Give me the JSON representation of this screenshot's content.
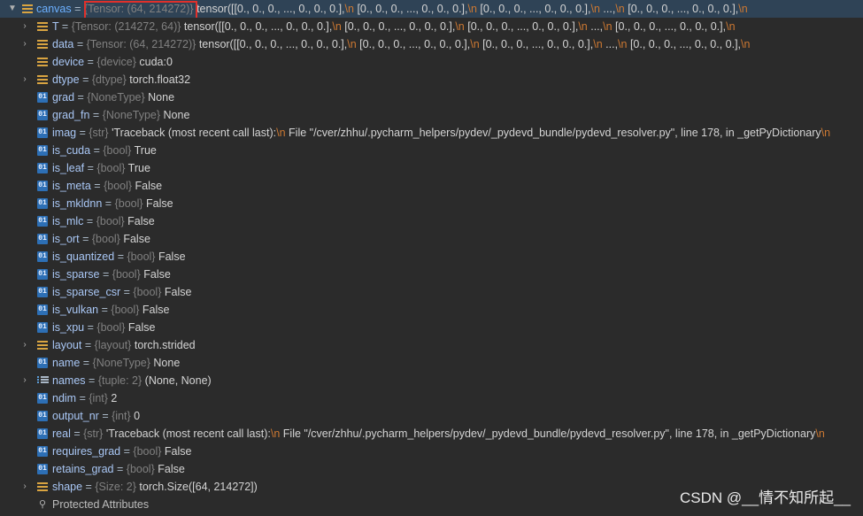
{
  "rows": [
    {
      "name": "canvas",
      "type": "{Tensor: (64, 214272)}",
      "value": "tensor([[0., 0., 0.,  ..., 0., 0., 0.],\\n         [0., 0., 0.,  ..., 0., 0., 0.],\\n         [0., 0., 0.,  ..., 0., 0., 0.],\\n         ...,\\n         [0., 0., 0.,  ..., 0., 0., 0.],\\n"
    },
    {
      "name": "T",
      "type": "{Tensor: (214272, 64)}",
      "value": "tensor([[0., 0., 0.,  ..., 0., 0., 0.],\\n         [0., 0., 0.,  ..., 0., 0., 0.],\\n         [0., 0., 0.,  ..., 0., 0., 0.],\\n         ...,\\n         [0., 0., 0.,  ..., 0., 0., 0.],\\n"
    },
    {
      "name": "data",
      "type": "{Tensor: (64, 214272)}",
      "value": "tensor([[0., 0., 0.,  ..., 0., 0., 0.],\\n         [0., 0., 0.,  ..., 0., 0., 0.],\\n         [0., 0., 0.,  ..., 0., 0., 0.],\\n         ...,\\n         [0., 0., 0.,  ..., 0., 0., 0.],\\n"
    },
    {
      "name": "device",
      "type": "{device}",
      "value": "cuda:0"
    },
    {
      "name": "dtype",
      "type": "{dtype}",
      "value": "torch.float32"
    },
    {
      "name": "grad",
      "type": "{NoneType}",
      "value": "None"
    },
    {
      "name": "grad_fn",
      "type": "{NoneType}",
      "value": "None"
    },
    {
      "name": "imag",
      "type": "{str}",
      "value": "'Traceback (most recent call last):\\n  File \"/cver/zhhu/.pycharm_helpers/pydev/_pydevd_bundle/pydevd_resolver.py\", line 178, in _getPyDictionary\\n"
    },
    {
      "name": "is_cuda",
      "type": "{bool}",
      "value": "True"
    },
    {
      "name": "is_leaf",
      "type": "{bool}",
      "value": "True"
    },
    {
      "name": "is_meta",
      "type": "{bool}",
      "value": "False"
    },
    {
      "name": "is_mkldnn",
      "type": "{bool}",
      "value": "False"
    },
    {
      "name": "is_mlc",
      "type": "{bool}",
      "value": "False"
    },
    {
      "name": "is_ort",
      "type": "{bool}",
      "value": "False"
    },
    {
      "name": "is_quantized",
      "type": "{bool}",
      "value": "False"
    },
    {
      "name": "is_sparse",
      "type": "{bool}",
      "value": "False"
    },
    {
      "name": "is_sparse_csr",
      "type": "{bool}",
      "value": "False"
    },
    {
      "name": "is_vulkan",
      "type": "{bool}",
      "value": "False"
    },
    {
      "name": "is_xpu",
      "type": "{bool}",
      "value": "False"
    },
    {
      "name": "layout",
      "type": "{layout}",
      "value": "torch.strided"
    },
    {
      "name": "name",
      "type": "{NoneType}",
      "value": "None"
    },
    {
      "name": "names",
      "type": "{tuple: 2}",
      "value": "(None, None)"
    },
    {
      "name": "ndim",
      "type": "{int}",
      "value": "2"
    },
    {
      "name": "output_nr",
      "type": "{int}",
      "value": "0"
    },
    {
      "name": "real",
      "type": "{str}",
      "value": "'Traceback (most recent call last):\\n  File \"/cver/zhhu/.pycharm_helpers/pydev/_pydevd_bundle/pydevd_resolver.py\", line 178, in _getPyDictionary\\n"
    },
    {
      "name": "requires_grad",
      "type": "{bool}",
      "value": "False"
    },
    {
      "name": "retains_grad",
      "type": "{bool}",
      "value": "False"
    },
    {
      "name": "shape",
      "type": "{Size: 2}",
      "value": "torch.Size([64, 214272])"
    },
    {
      "label": "Protected Attributes"
    }
  ],
  "equals": "=",
  "watermark": "CSDN @__情不知所起__"
}
